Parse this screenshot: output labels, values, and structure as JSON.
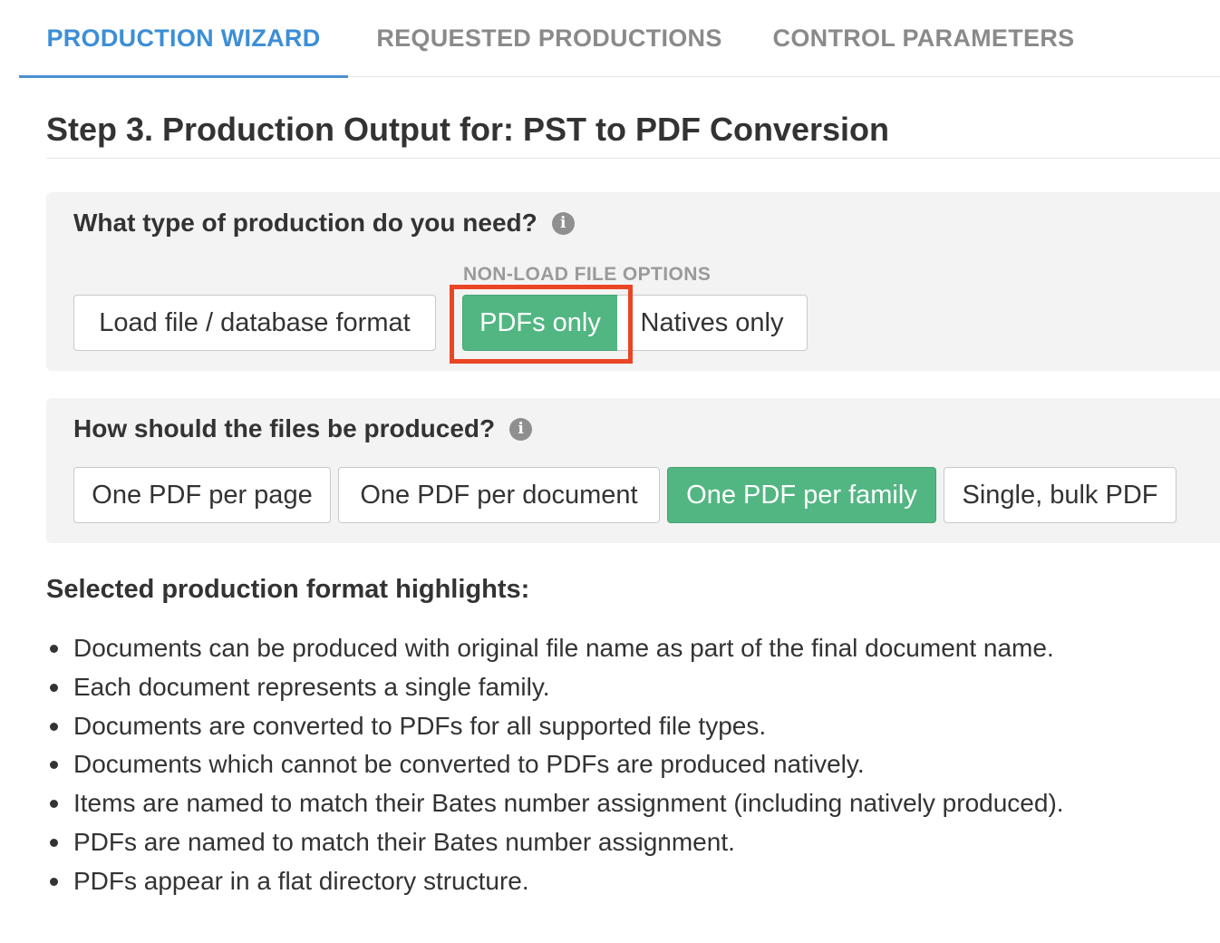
{
  "tabs": [
    {
      "label": "PRODUCTION WIZARD",
      "active": true
    },
    {
      "label": "REQUESTED PRODUCTIONS",
      "active": false
    },
    {
      "label": "CONTROL PARAMETERS",
      "active": false
    }
  ],
  "step_title": "Step 3. Production Output for: PST to PDF Conversion",
  "production_type": {
    "question": "What type of production do you need?",
    "info_icon": "i",
    "group_caption": "NON-LOAD FILE OPTIONS",
    "options": [
      {
        "label": "Load file / database format",
        "selected": false
      },
      {
        "label": "PDFs only",
        "selected": true
      },
      {
        "label": "Natives only",
        "selected": false
      }
    ]
  },
  "file_production": {
    "question": "How should the files be produced?",
    "info_icon": "i",
    "options": [
      {
        "label": "One PDF per page",
        "selected": false
      },
      {
        "label": "One PDF per document",
        "selected": false
      },
      {
        "label": "One PDF per family",
        "selected": true
      },
      {
        "label": "Single, bulk PDF",
        "selected": false
      }
    ]
  },
  "highlights": {
    "title": "Selected production format highlights:",
    "items": [
      "Documents can be produced with original file name as part of the final document name.",
      "Each document represents a single family.",
      "Documents are converted to PDFs for all supported file types.",
      "Documents which cannot be converted to PDFs are produced natively.",
      "Items are named to match their Bates number assignment (including natively produced).",
      "PDFs are named to match their Bates number assignment.",
      "PDFs appear in a flat directory structure."
    ]
  },
  "colors": {
    "active_tab": "#3c8ed6",
    "selected_button": "#52b682",
    "highlight_outline": "#ea4524"
  }
}
